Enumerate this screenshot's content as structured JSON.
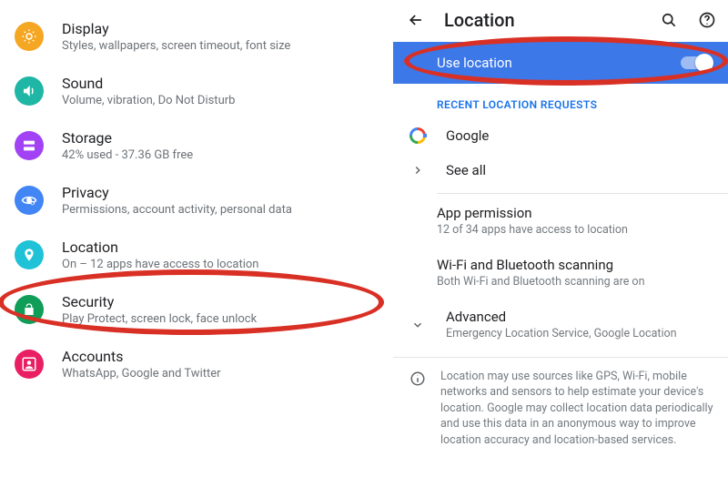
{
  "left": {
    "items": [
      {
        "title": "Display",
        "sub": "Styles, wallpapers, screen timeout, font size"
      },
      {
        "title": "Sound",
        "sub": "Volume, vibration, Do Not Disturb"
      },
      {
        "title": "Storage",
        "sub": "42% used - 37.36 GB free"
      },
      {
        "title": "Privacy",
        "sub": "Permissions, account activity, personal data"
      },
      {
        "title": "Location",
        "sub": "On – 12 apps have access to location"
      },
      {
        "title": "Security",
        "sub": "Play Protect, screen lock, face unlock"
      },
      {
        "title": "Accounts",
        "sub": "WhatsApp, Google and Twitter"
      }
    ]
  },
  "right": {
    "header_title": "Location",
    "use_location_label": "Use location",
    "use_location_state": "on",
    "section_recent": "RECENT LOCATION REQUESTS",
    "google": "Google",
    "see_all": "See all",
    "app_perm_title": "App permission",
    "app_perm_sub": "12 of 34 apps have access to location",
    "scan_title": "Wi-Fi and Bluetooth scanning",
    "scan_sub": "Both Wi-Fi and Bluetooth scanning are on",
    "advanced_title": "Advanced",
    "advanced_sub": "Emergency Location Service, Google Location",
    "info_text": "Location may use sources like GPS, Wi-Fi, mobile networks and sensors to help estimate your device's location. Google may collect location data periodically and use this data in an anonymous way to improve location accuracy and location-based services."
  },
  "colors": {
    "display": "#f5a623",
    "sound": "#1fb6a6",
    "storage": "#a142f4",
    "privacy": "#4285f4",
    "location": "#1fc2d6",
    "security": "#0f9d58",
    "accounts": "#e91e63",
    "blue_bar": "#3c78e7",
    "annotation": "#d93025"
  }
}
